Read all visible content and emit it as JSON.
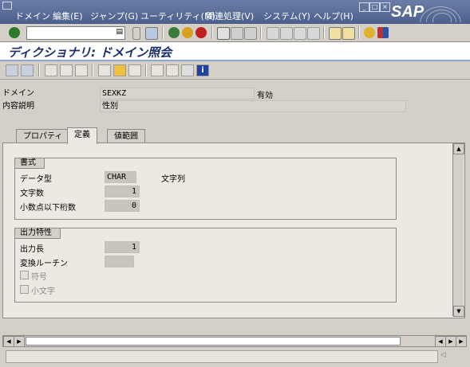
{
  "menu": {
    "items": [
      "ドメイン",
      "編集(E)",
      "ジャンプ(G)",
      "ユーティリティ(M)",
      "関連処理(V)",
      "システム(Y)",
      "ヘルプ(H)"
    ],
    "brand": "SAP"
  },
  "toolbar": {
    "command_value": "",
    "icons": [
      "ok-checkmark",
      "save",
      "back",
      "exit",
      "cancel",
      "print",
      "find",
      "find-next",
      "first-page",
      "previous-page",
      "next-page",
      "last-page",
      "create-session",
      "generate-shortcut",
      "help",
      "customize-layout"
    ]
  },
  "title": "ディクショナリ: ドメイン照会",
  "app_toolbar": {
    "icons": [
      "back-arrow",
      "forward-arrow",
      "display-change",
      "active-inactive",
      "other-object",
      "check",
      "activate",
      "where-used",
      "hierarchy",
      "display-object-list",
      "info"
    ]
  },
  "header": {
    "domain_label": "ドメイン",
    "domain_value": "SEXKZ",
    "status": "有効",
    "description_label": "内容説明",
    "description_value": "性別"
  },
  "tabs": [
    {
      "label": "プロパティ",
      "active": false
    },
    {
      "label": "定義",
      "active": true
    },
    {
      "label": "値範囲",
      "active": false
    }
  ],
  "format": {
    "title": "書式",
    "datatype_label": "データ型",
    "datatype_value": "CHAR",
    "datatype_text": "文字列",
    "length_label": "文字数",
    "length_value": "1",
    "decimals_label": "小数点以下桁数",
    "decimals_value": "0"
  },
  "output": {
    "title": "出力特性",
    "outlen_label": "出力長",
    "outlen_value": "1",
    "conv_label": "変換ルーチン",
    "conv_value": "",
    "sign_label": "符号",
    "sign_checked": false,
    "lowercase_label": "小文字",
    "lowercase_checked": false
  },
  "colors": {
    "menubar": "#4a5f8c",
    "title_text": "#1b2f66",
    "background": "#d4d0c8"
  }
}
